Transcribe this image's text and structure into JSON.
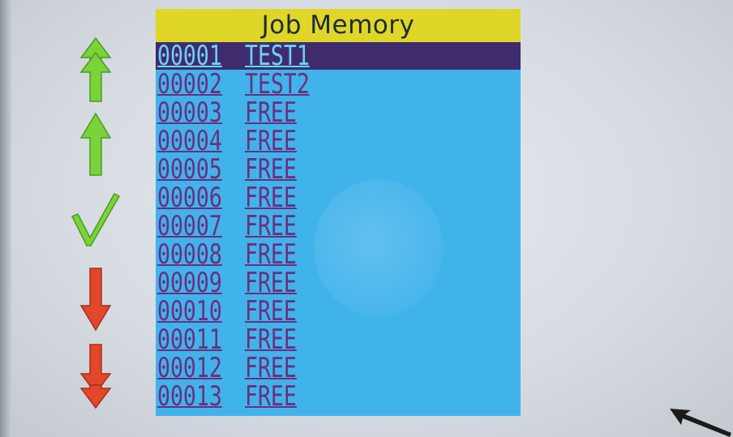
{
  "screen": {
    "title": "Job Memory",
    "colors": {
      "list_background": "#41b3eb",
      "title_background": "#dfd628",
      "selection_background": "#3e2c6e",
      "row_text": "#6b2f7e",
      "selected_text": "#6ed2f6",
      "up_arrows": "#7bd33a",
      "checkmark": "#7bd33a",
      "down_arrows": "#e2472a"
    }
  },
  "navigation": {
    "buttons": [
      {
        "icon": "double-up-arrow-icon",
        "action": "page-up"
      },
      {
        "icon": "up-arrow-icon",
        "action": "up"
      },
      {
        "icon": "checkmark-icon",
        "action": "select"
      },
      {
        "icon": "down-arrow-icon",
        "action": "down"
      },
      {
        "icon": "double-down-arrow-icon",
        "action": "page-down"
      }
    ]
  },
  "jobs": [
    {
      "number": "00001",
      "name": "TEST1",
      "selected": true
    },
    {
      "number": "00002",
      "name": "TEST2",
      "selected": false
    },
    {
      "number": "00003",
      "name": "FREE",
      "selected": false
    },
    {
      "number": "00004",
      "name": "FREE",
      "selected": false
    },
    {
      "number": "00005",
      "name": "FREE",
      "selected": false
    },
    {
      "number": "00006",
      "name": "FREE",
      "selected": false
    },
    {
      "number": "00007",
      "name": "FREE",
      "selected": false
    },
    {
      "number": "00008",
      "name": "FREE",
      "selected": false
    },
    {
      "number": "00009",
      "name": "FREE",
      "selected": false
    },
    {
      "number": "00010",
      "name": "FREE",
      "selected": false
    },
    {
      "number": "00011",
      "name": "FREE",
      "selected": false
    },
    {
      "number": "00012",
      "name": "FREE",
      "selected": false
    },
    {
      "number": "00013",
      "name": "FREE",
      "selected": false
    }
  ]
}
